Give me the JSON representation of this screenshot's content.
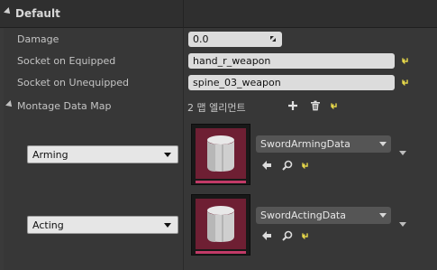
{
  "category": {
    "title": "Default"
  },
  "rows": {
    "damage": {
      "label": "Damage",
      "value": "0.0"
    },
    "socket_equipped": {
      "label": "Socket on Equipped",
      "value": "hand_r_weapon"
    },
    "socket_unequipped": {
      "label": "Socket on Unequipped",
      "value": "spine_03_weapon"
    },
    "montage_map": {
      "label": "Montage Data Map",
      "count": "2 맵 엘리먼트"
    }
  },
  "entries": [
    {
      "key": "Arming",
      "asset": "SwordArmingData"
    },
    {
      "key": "Acting",
      "asset": "SwordActingData"
    }
  ],
  "icons": {
    "reset": "reset-to-default-icon",
    "add": "plus-icon",
    "delete": "trash-icon",
    "browse": "arrow-left-icon",
    "find": "magnifier-icon"
  },
  "colors": {
    "reset_yellow": "#e8d94a",
    "thumb_bg": "#6e1f33",
    "thumb_bar": "#c23a67"
  }
}
